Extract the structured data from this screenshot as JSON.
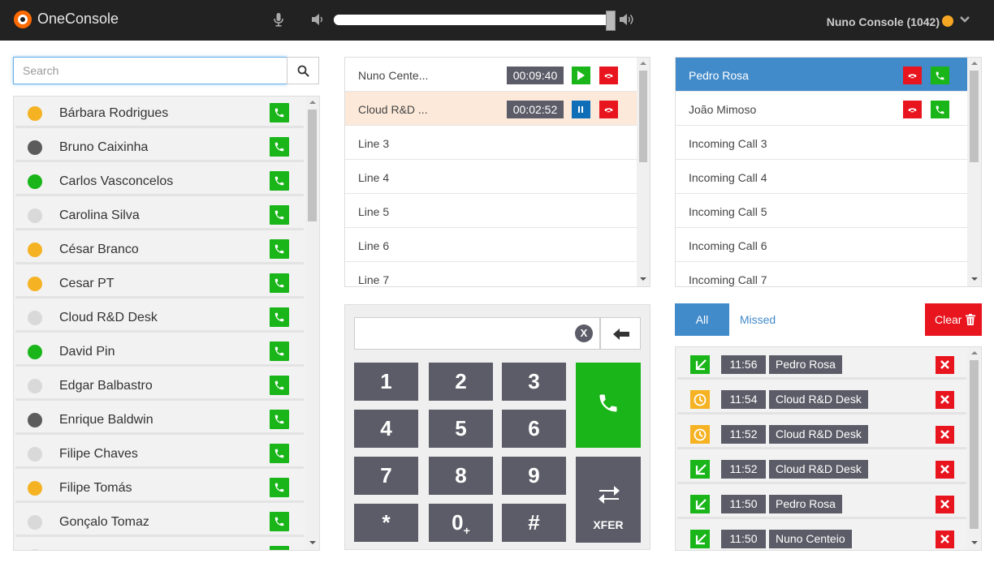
{
  "app": {
    "title": "OneConsole"
  },
  "volume": {
    "level": 0.99
  },
  "console": {
    "name": "Nuno Console (1042)"
  },
  "search": {
    "placeholder": "Search"
  },
  "status_colors": {
    "away": "#f5b324",
    "offline": "#5c5c5c",
    "available": "#19b519",
    "unknown": "#d9d9d9"
  },
  "contacts": [
    {
      "name": "Bárbara Rodrigues",
      "status": "away"
    },
    {
      "name": "Bruno Caixinha",
      "status": "offline"
    },
    {
      "name": "Carlos Vasconcelos",
      "status": "available"
    },
    {
      "name": "Carolina Silva",
      "status": "unknown"
    },
    {
      "name": "César Branco",
      "status": "away"
    },
    {
      "name": "Cesar PT",
      "status": "away"
    },
    {
      "name": "Cloud R&D Desk",
      "status": "unknown"
    },
    {
      "name": "David Pin",
      "status": "available"
    },
    {
      "name": "Edgar Balbastro",
      "status": "unknown"
    },
    {
      "name": "Enrique Baldwin",
      "status": "offline"
    },
    {
      "name": "Filipe Chaves",
      "status": "unknown"
    },
    {
      "name": "Filipe Tomás",
      "status": "away"
    },
    {
      "name": "Gonçalo Tomaz",
      "status": "unknown"
    },
    {
      "name": "",
      "status": "unknown"
    }
  ],
  "lines": [
    {
      "label": "Nuno Cente...",
      "timer": "00:09:40",
      "state": "on-hold",
      "active": false
    },
    {
      "label": "Cloud R&D ...",
      "timer": "00:02:52",
      "state": "active",
      "active": true
    },
    {
      "label": "Line 3"
    },
    {
      "label": "Line 4"
    },
    {
      "label": "Line 5"
    },
    {
      "label": "Line 6"
    },
    {
      "label": "Line 7"
    }
  ],
  "dialpad": {
    "clear_label": "X",
    "keys": [
      "1",
      "2",
      "3",
      "4",
      "5",
      "6",
      "7",
      "8",
      "9",
      "*",
      "0",
      "#"
    ],
    "zero_sub": "+",
    "xfer_label": "XFER"
  },
  "incoming": [
    {
      "label": "Pedro Rosa",
      "selected": true,
      "ringing": true
    },
    {
      "label": "João Mimoso",
      "selected": false,
      "ringing": true
    },
    {
      "label": "Incoming Call 3"
    },
    {
      "label": "Incoming Call 4"
    },
    {
      "label": "Incoming Call 5"
    },
    {
      "label": "Incoming Call 6"
    },
    {
      "label": "Incoming Call 7"
    }
  ],
  "history_tabs": {
    "all": "All",
    "missed": "Missed",
    "clear": "Clear"
  },
  "history": [
    {
      "type": "answered",
      "time": "11:56",
      "name": "Pedro Rosa"
    },
    {
      "type": "missed",
      "time": "11:54",
      "name": "Cloud R&D Desk"
    },
    {
      "type": "missed",
      "time": "11:52",
      "name": "Cloud R&D Desk"
    },
    {
      "type": "answered",
      "time": "11:52",
      "name": "Cloud R&D Desk"
    },
    {
      "type": "answered",
      "time": "11:50",
      "name": "Pedro Rosa"
    },
    {
      "type": "answered",
      "time": "11:50",
      "name": "Nuno Centeio"
    }
  ]
}
